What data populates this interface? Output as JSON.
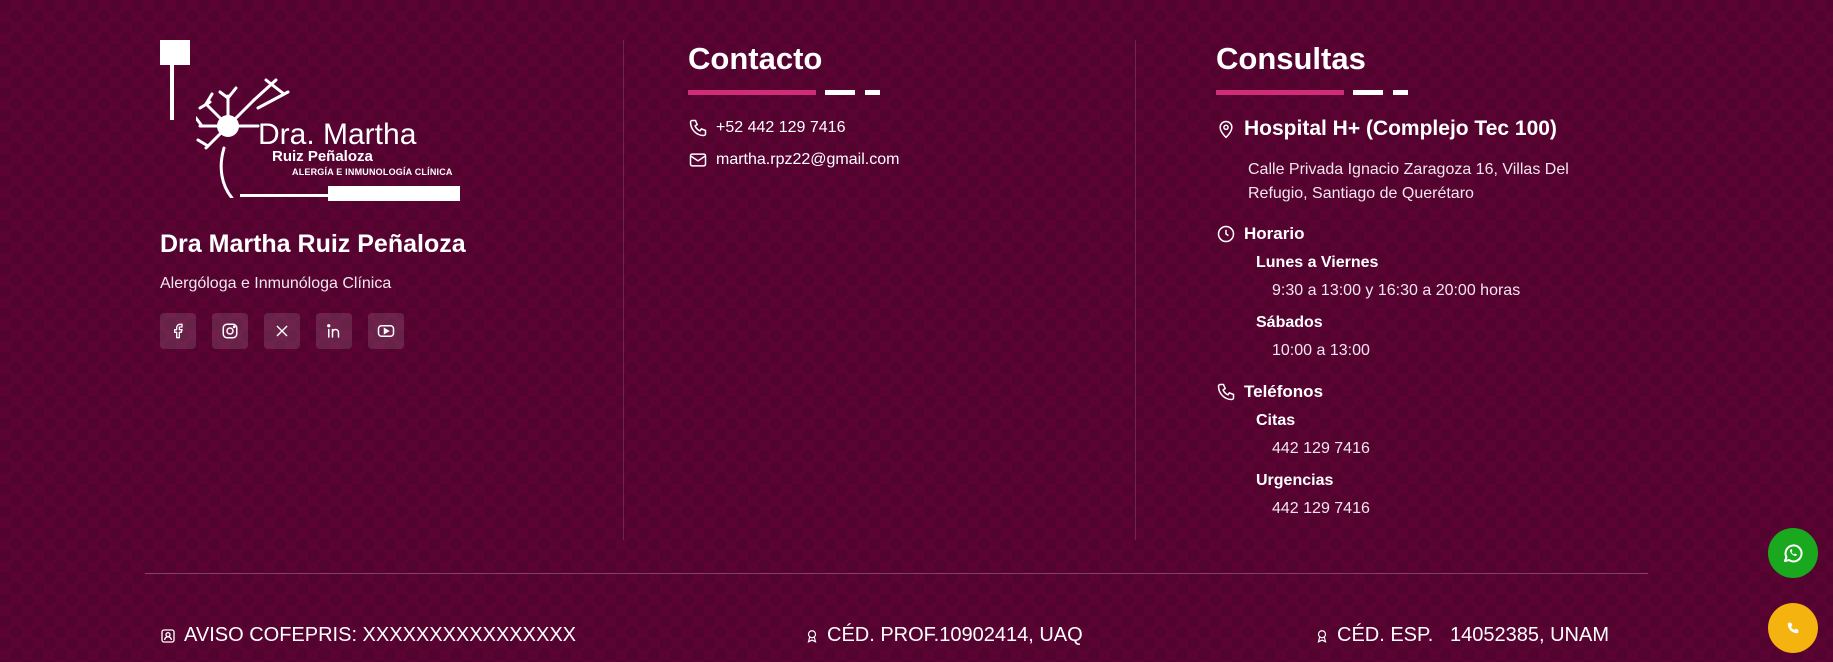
{
  "brand": {
    "logo_title": "Dra. Martha",
    "logo_subtitle": "Ruiz Peñaloza",
    "logo_tagline": "ALERGÍA E INMUNOLOGÍA CLÍNICA",
    "doctor_name": "Dra Martha Ruiz Peñaloza",
    "doctor_role": "Alergóloga e Inmunóloga Clínica"
  },
  "socials": [
    {
      "icon": "facebook-icon"
    },
    {
      "icon": "instagram-icon"
    },
    {
      "icon": "x-twitter-icon"
    },
    {
      "icon": "linkedin-icon"
    },
    {
      "icon": "youtube-icon"
    }
  ],
  "contact": {
    "heading": "Contacto",
    "phone": "+52 442 129 7416",
    "email": "martha.rpz22@gmail.com"
  },
  "consultas": {
    "heading": "Consultas",
    "location_title": "Hospital H+ (Complejo Tec 100)",
    "address_line1": "Calle Privada Ignacio Zaragoza 16, Villas Del",
    "address_line2": "Refugio, Santiago de Querétaro",
    "horario": {
      "label": "Horario",
      "weekdays_label": "Lunes a Viernes",
      "weekdays_hours": "9:30 a 13:00 y 16:30 a 20:00 horas",
      "saturday_label": "Sábados",
      "saturday_hours": "10:00 a 13:00"
    },
    "telefonos": {
      "label": "Teléfonos",
      "citas_label": "Citas",
      "citas_number": "442 129 7416",
      "urgencias_label": "Urgencias",
      "urgencias_number": "442 129 7416"
    }
  },
  "bottom": {
    "cofepris": "AVISO COFEPRIS: XXXXXXXXXXXXXXXX",
    "ced_prof": "CÉD. PROF.10902414, UAQ",
    "ced_esp": "CÉD. ESP.   14052385, UNAM"
  },
  "colors": {
    "background": "#5b0434",
    "accent": "#d12c77",
    "whatsapp": "#1aa81f",
    "call": "#f4b30f"
  }
}
